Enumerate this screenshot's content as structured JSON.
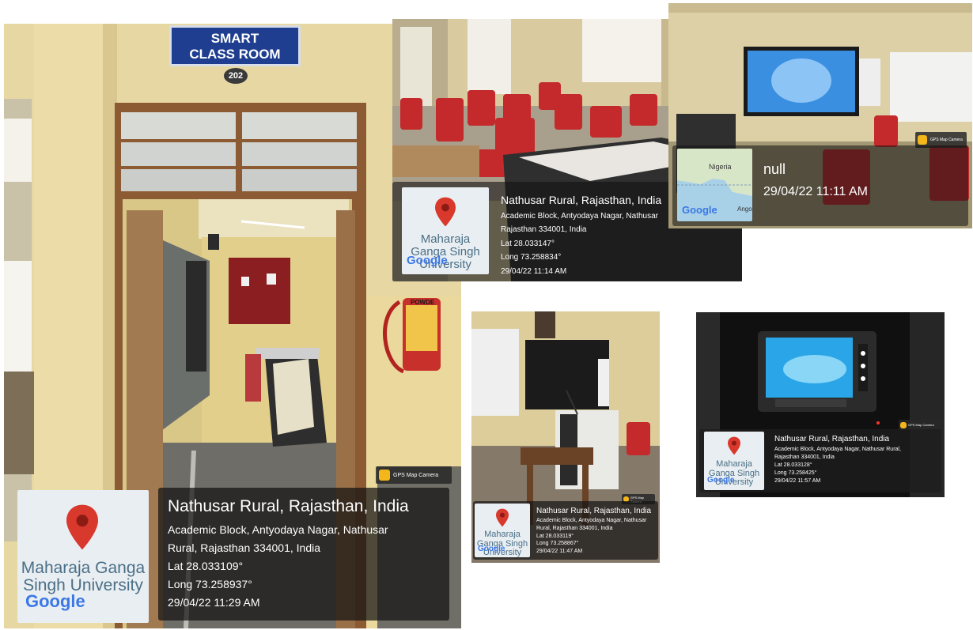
{
  "photos": {
    "entrance": {
      "sign_line1": "SMART",
      "sign_line2": "CLASS ROOM",
      "room_number": "202",
      "extinguisher_label": "POWDE",
      "camera_badge": "GPS Map Camera",
      "map_label": "Maharaja Ganga Singh University",
      "map_logo": "Google",
      "title": "Nathusar Rural, Rajasthan, India",
      "address1": "Academic Block, Antyodaya Nagar, Nathusar",
      "address2": "Rural, Rajasthan 334001, India",
      "lat": "Lat 28.033109°",
      "long": "Long 73.258937°",
      "datetime": "29/04/22 11:29 AM"
    },
    "chairs": {
      "map_label": "Maharaja Ganga Singh University",
      "map_logo": "Google",
      "title": "Nathusar Rural, Rajasthan, India",
      "address1": "Academic Block, Antyodaya Nagar, Nathusar",
      "address2": "Rajasthan 334001, India",
      "lat": "Lat 28.033147°",
      "long": "Long 73.258834°",
      "datetime": "29/04/22 11:14 AM"
    },
    "screen": {
      "camera_badge": "GPS Map Camera",
      "map_country": "Nigeria",
      "map_country2": "Ango",
      "map_logo": "Google",
      "title": "null",
      "datetime": "29/04/22 11:11 AM"
    },
    "podium": {
      "camera_badge": "GPS Map Camera",
      "map_label": "Maharaja Ganga Singh University",
      "map_logo": "Google",
      "title": "Nathusar Rural, Rajasthan, India",
      "address1": "Academic Block, Antyodaya Nagar, Nathusar",
      "address2": "Rural, Rajasthan 334001, India",
      "lat": "Lat 28.033119°",
      "long": "Long 73.258867°",
      "datetime": "29/04/22 11:47 AM"
    },
    "panel": {
      "camera_badge": "GPS Map Camera",
      "map_label": "Maharaja Ganga Singh University",
      "map_logo": "Google",
      "title": "Nathusar Rural, Rajasthan, India",
      "address1": "Academic Block, Antyodaya Nagar, Nathusar Rural,",
      "address2": "Rajasthan 334001, India",
      "lat": "Lat 28.033128°",
      "long": "Long 73.258425°",
      "datetime": "29/04/22 11:57 AM"
    }
  },
  "colors": {
    "wall": "#e9d9a4",
    "door_frame": "#8c5a33",
    "chair_red": "#c4292b",
    "screen_blue": "#3a8fe0",
    "overlay": "#121212",
    "pin_red": "#d9382c",
    "sign_blue": "#1f3e8f"
  }
}
